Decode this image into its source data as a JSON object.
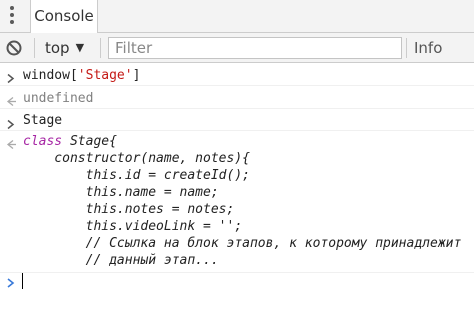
{
  "tab": {
    "label": "Console"
  },
  "toolbar": {
    "context": "top",
    "filter_placeholder": "Filter",
    "level": "Info"
  },
  "entries": [
    {
      "type": "input",
      "prefix": "window[",
      "string": "'Stage'",
      "suffix": "]"
    },
    {
      "type": "output",
      "text": "undefined"
    },
    {
      "type": "input",
      "text": "Stage"
    },
    {
      "type": "output",
      "keyword": "class",
      "lines": [
        " Stage{",
        "    constructor(name, notes){",
        "        this.id = createId();",
        "        this.name = name;",
        "        this.notes = notes;",
        "        this.videoLink = '';",
        "        // Ссылка на блок этапов, к которому принадлежит",
        "        // данный этап..."
      ]
    }
  ],
  "colors": {
    "string": "#c41a16",
    "keyword": "#a626a4",
    "prompt": "#3879d9"
  }
}
